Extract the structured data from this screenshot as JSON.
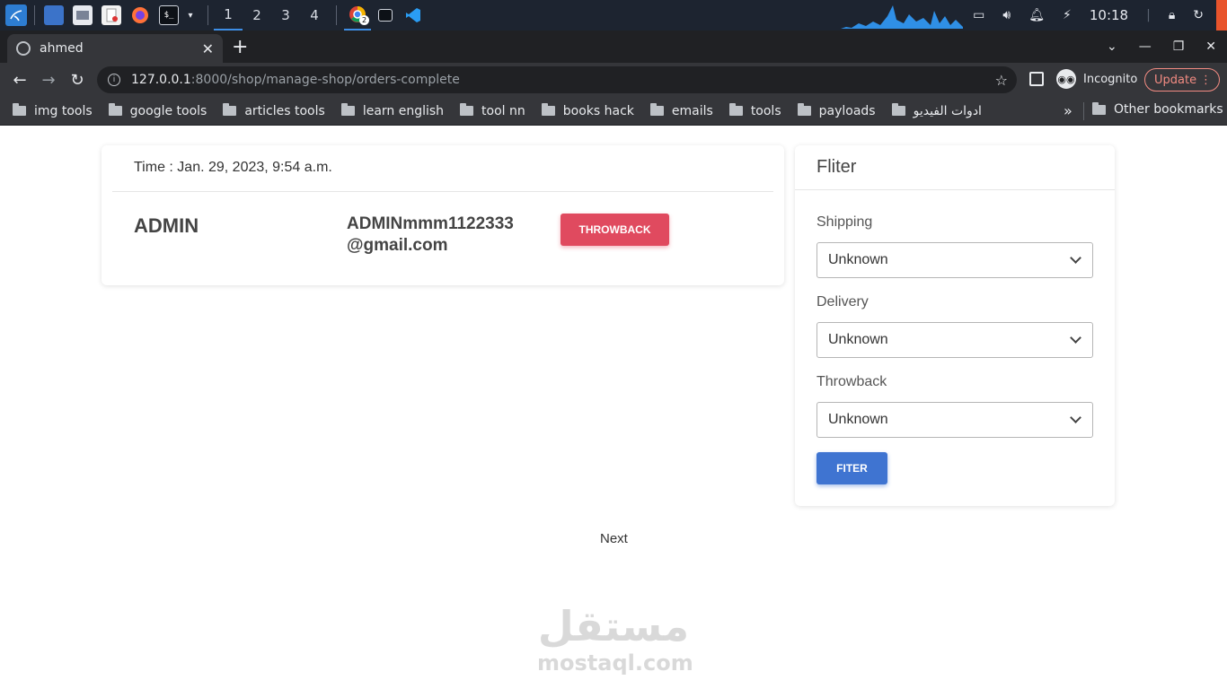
{
  "taskbar": {
    "workspaces": [
      "1",
      "2",
      "3",
      "4"
    ],
    "chrome_badge": "2",
    "clock": "10:18",
    "icons": [
      "kali-menu-icon",
      "desktop-icon",
      "file-manager-icon",
      "text-editor-icon",
      "firefox-icon",
      "terminal-icon",
      "chrome-icon",
      "terminal-window-icon",
      "vscode-icon"
    ]
  },
  "browser": {
    "tab_title": "ahmed",
    "url_host": "127.0.0.1",
    "url_path": ":8000/shop/manage-shop/orders-complete",
    "profile_label": "Incognito",
    "update_label": "Update",
    "bookmarks": [
      "img tools",
      "google tools",
      "articles tools",
      "learn english",
      "tool nn",
      "books hack",
      "emails",
      "tools",
      "payloads",
      "ادوات الفيديو"
    ],
    "other_bookmarks": "Other bookmarks"
  },
  "order": {
    "time": "Time : Jan. 29, 2023, 9:54 a.m.",
    "user": "ADMIN",
    "email": "ADMINmmm1122333 @gmail.com",
    "action_label": "THROWBACK"
  },
  "filter": {
    "title": "Fliter",
    "fields": [
      {
        "label": "Shipping",
        "value": "Unknown"
      },
      {
        "label": "Delivery",
        "value": "Unknown"
      },
      {
        "label": "Throwback",
        "value": "Unknown"
      }
    ],
    "submit_label": "FITER"
  },
  "pagination": {
    "next_label": "Next"
  },
  "watermark": {
    "arabic": "مستقل",
    "latin": "mostaql.com"
  },
  "colors": {
    "throwback_button": "#e04a5f",
    "filter_button": "#3f74d1",
    "taskbar": "#1d2430",
    "browser_chrome": "#35363a"
  }
}
